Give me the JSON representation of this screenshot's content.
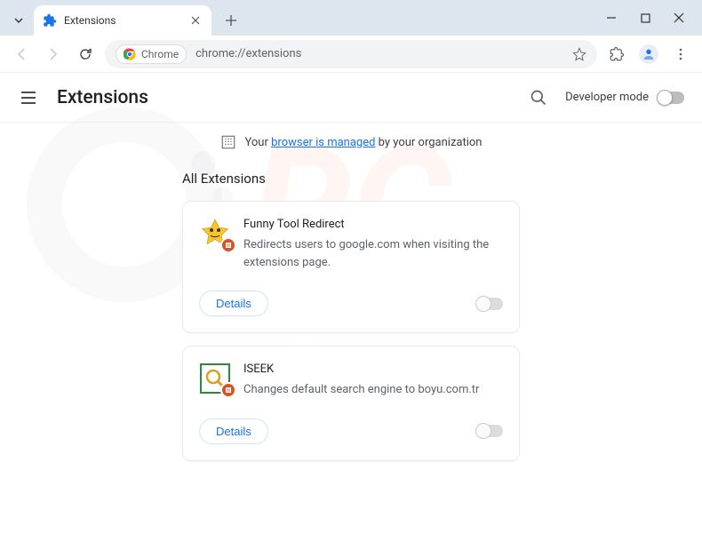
{
  "tab": {
    "title": "Extensions"
  },
  "address": {
    "chip_label": "Chrome",
    "url": "chrome://extensions"
  },
  "header": {
    "title": "Extensions",
    "dev_mode_label": "Developer mode"
  },
  "banner": {
    "prefix": "Your ",
    "link": "browser is managed",
    "suffix": " by your organization"
  },
  "section": {
    "title": "All Extensions"
  },
  "extensions": [
    {
      "name": "Funny Tool Redirect",
      "description": "Redirects users to google.com when visiting the extensions page.",
      "details_label": "Details"
    },
    {
      "name": "ISEEK",
      "description": "Changes default search engine to boyu.com.tr",
      "details_label": "Details"
    }
  ]
}
